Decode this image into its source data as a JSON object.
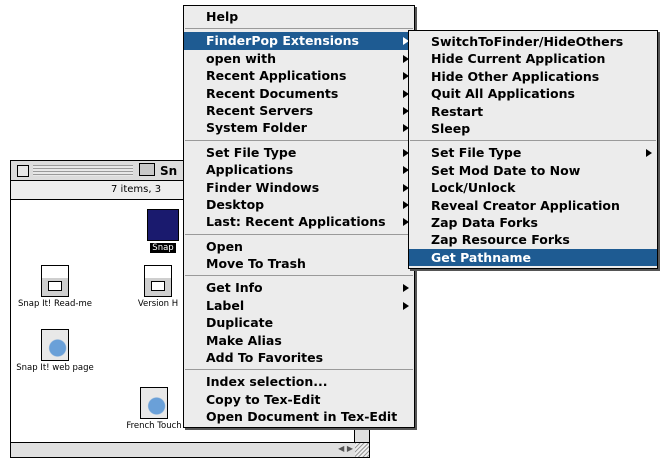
{
  "finder": {
    "title": "Sn",
    "info": "7 items, 3",
    "icons": [
      {
        "name": "Snap It! Read-me"
      },
      {
        "name": "Version H"
      },
      {
        "name": "Snap It! web page"
      },
      {
        "name": "Snap"
      },
      {
        "name": "French Touch"
      }
    ]
  },
  "main_menu": {
    "items": [
      {
        "label": "Help"
      },
      {
        "label": "FinderPop Extensions"
      },
      {
        "label": "open with"
      },
      {
        "label": "Recent Applications"
      },
      {
        "label": "Recent Documents"
      },
      {
        "label": "Recent Servers"
      },
      {
        "label": "System Folder"
      },
      {
        "label": "Set File Type"
      },
      {
        "label": "Applications"
      },
      {
        "label": "Finder Windows"
      },
      {
        "label": "Desktop"
      },
      {
        "label": "Last: Recent Applications"
      },
      {
        "label": "Open"
      },
      {
        "label": "Move To Trash"
      },
      {
        "label": "Get Info"
      },
      {
        "label": "Label"
      },
      {
        "label": "Duplicate"
      },
      {
        "label": "Make Alias"
      },
      {
        "label": "Add To Favorites"
      },
      {
        "label": "Index selection..."
      },
      {
        "label": "Copy to Tex-Edit"
      },
      {
        "label": "Open Document in Tex-Edit"
      }
    ]
  },
  "sub_menu": {
    "items": [
      {
        "label": "SwitchToFinder/HideOthers"
      },
      {
        "label": "Hide Current Application"
      },
      {
        "label": "Hide Other Applications"
      },
      {
        "label": "Quit All Applications"
      },
      {
        "label": "Restart"
      },
      {
        "label": "Sleep"
      },
      {
        "label": "Set File Type"
      },
      {
        "label": "Set Mod Date to Now"
      },
      {
        "label": "Lock/Unlock"
      },
      {
        "label": "Reveal Creator Application"
      },
      {
        "label": "Zap Data Forks"
      },
      {
        "label": "Zap Resource Forks"
      },
      {
        "label": "Get Pathname"
      }
    ]
  },
  "colors": {
    "menu_bg": "#ececec",
    "highlight": "#1e5b92",
    "highlight_text": "#ffffff"
  }
}
